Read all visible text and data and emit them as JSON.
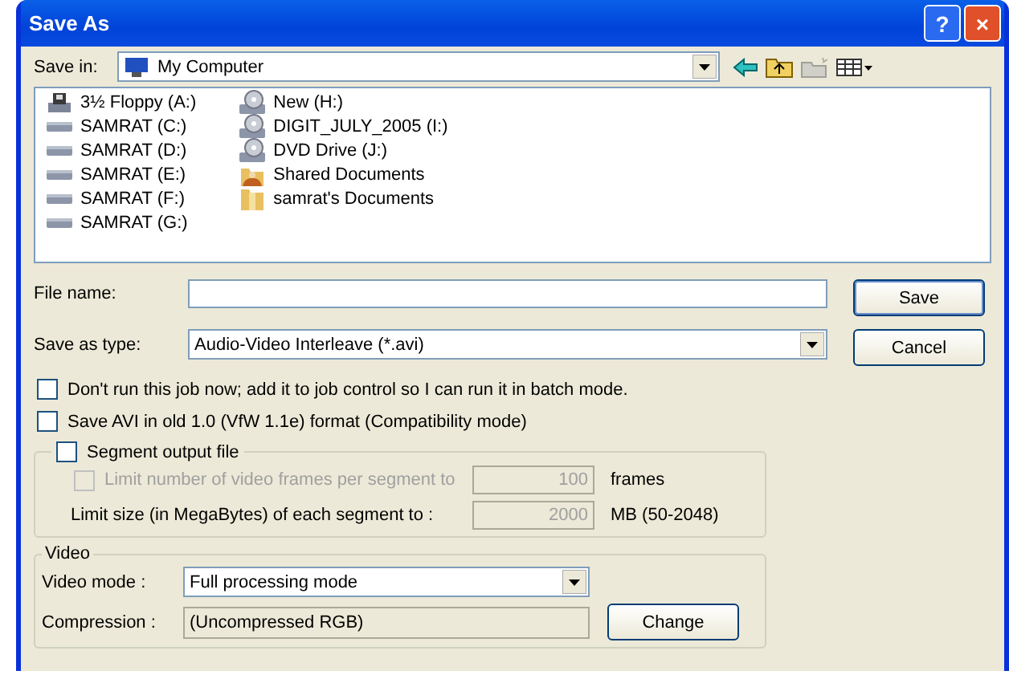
{
  "window": {
    "title": "Save As",
    "title_buttons": [
      "?",
      "×"
    ]
  },
  "save_in": {
    "label": "Save in:",
    "value": "My Computer"
  },
  "files": [
    {
      "name": "3½ Floppy (A:)",
      "kind": "floppy"
    },
    {
      "name": "SAMRAT (C:)",
      "kind": "disk"
    },
    {
      "name": "SAMRAT (D:)",
      "kind": "disk"
    },
    {
      "name": "SAMRAT (E:)",
      "kind": "disk"
    },
    {
      "name": "SAMRAT (F:)",
      "kind": "disk"
    },
    {
      "name": "SAMRAT (G:)",
      "kind": "disk"
    },
    {
      "name": "New (H:)",
      "kind": "cd"
    },
    {
      "name": "DIGIT_JULY_2005 (I:)",
      "kind": "cd"
    },
    {
      "name": "DVD Drive (J:)",
      "kind": "cd"
    },
    {
      "name": "Shared Documents",
      "kind": "shared"
    },
    {
      "name": "samrat's Documents",
      "kind": "folder"
    }
  ],
  "file_name": {
    "label": "File name:"
  },
  "save_as_type": {
    "label": "Save as type:",
    "value": "Audio-Video Interleave (*.avi)"
  },
  "buttons": [
    "Save",
    "Cancel"
  ],
  "options": [
    {
      "label": "Don't run this job now; add it to job control so I can run it in batch mode.",
      "checked": false
    },
    {
      "label": "Save AVI in old 1.0 (VfW 1.1e) format (Compatibility mode)",
      "checked": false
    }
  ],
  "segment": {
    "label": "Segment output file",
    "checked": false,
    "frames": {
      "label": "Limit number of video frames per segment to",
      "checked": false,
      "disabled": true,
      "value": "100",
      "unit": "frames"
    },
    "size": {
      "label": "Limit size (in MegaBytes) of each segment to :",
      "value": "2000",
      "unit": "MB (50-2048)"
    }
  },
  "video": {
    "title": "Video",
    "mode_label": "Video mode :",
    "mode": "Full processing mode",
    "compression_label": "Compression :",
    "compression": "(Uncompressed RGB)",
    "change": "Change"
  }
}
